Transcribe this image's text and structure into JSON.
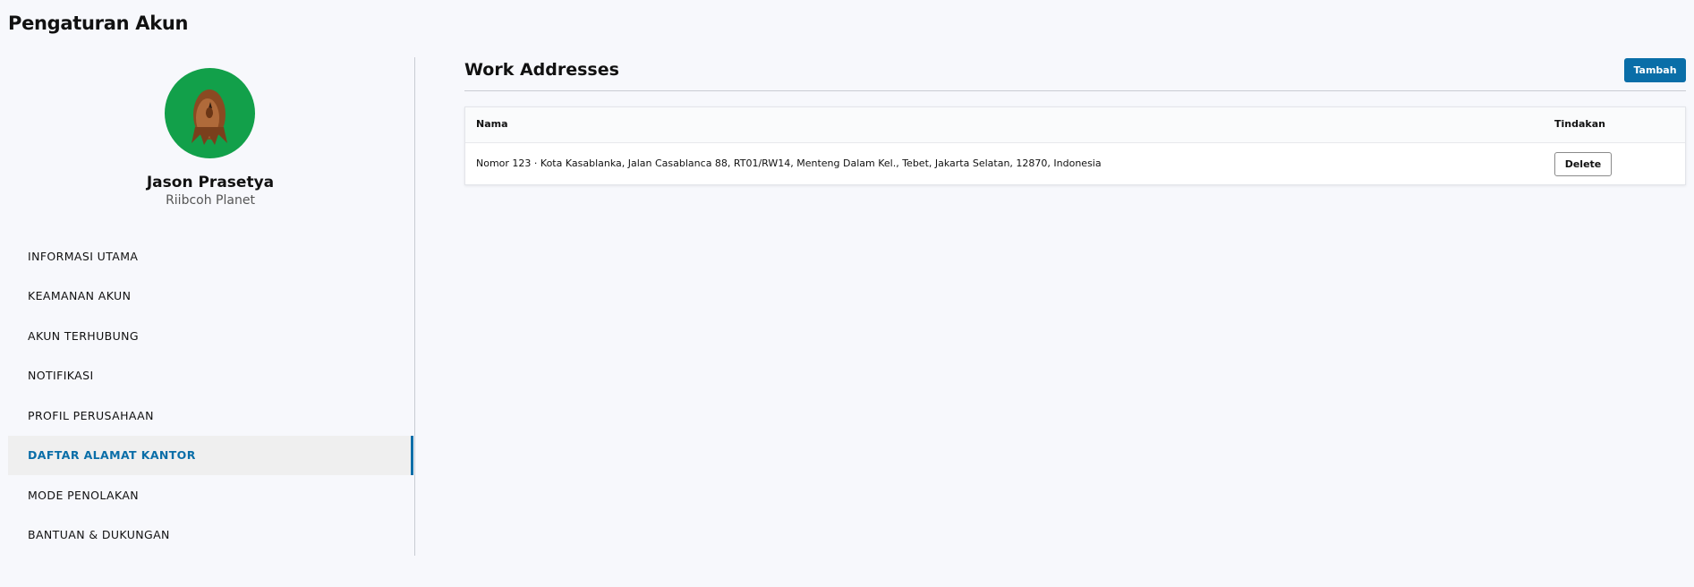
{
  "page": {
    "title": "Pengaturan Akun"
  },
  "profile": {
    "name": "Jason Prasetya",
    "company": "Riibcoh Planet",
    "avatar_bg": "#12a04a"
  },
  "sidebar": {
    "items": [
      {
        "label": "INFORMASI UTAMA",
        "active": false
      },
      {
        "label": "KEAMANAN AKUN",
        "active": false
      },
      {
        "label": "AKUN TERHUBUNG",
        "active": false
      },
      {
        "label": "NOTIFIKASI",
        "active": false
      },
      {
        "label": "PROFIL PERUSAHAAN",
        "active": false
      },
      {
        "label": "DAFTAR ALAMAT KANTOR",
        "active": true
      },
      {
        "label": "MODE PENOLAKAN",
        "active": false
      },
      {
        "label": "BANTUAN & DUKUNGAN",
        "active": false
      }
    ]
  },
  "main": {
    "section_title": "Work Addresses",
    "add_label": "Tambah",
    "table": {
      "headers": {
        "name": "Nama",
        "action": "Tindakan"
      },
      "rows": [
        {
          "name": "Nomor 123 · Kota Kasablanka, Jalan Casablanca 88, RT01/RW14, Menteng Dalam Kel., Tebet, Jakarta Selatan, 12870, Indonesia",
          "action_label": "Delete"
        }
      ]
    }
  },
  "colors": {
    "accent": "#0a6ea8",
    "background": "#f7f8fc"
  }
}
